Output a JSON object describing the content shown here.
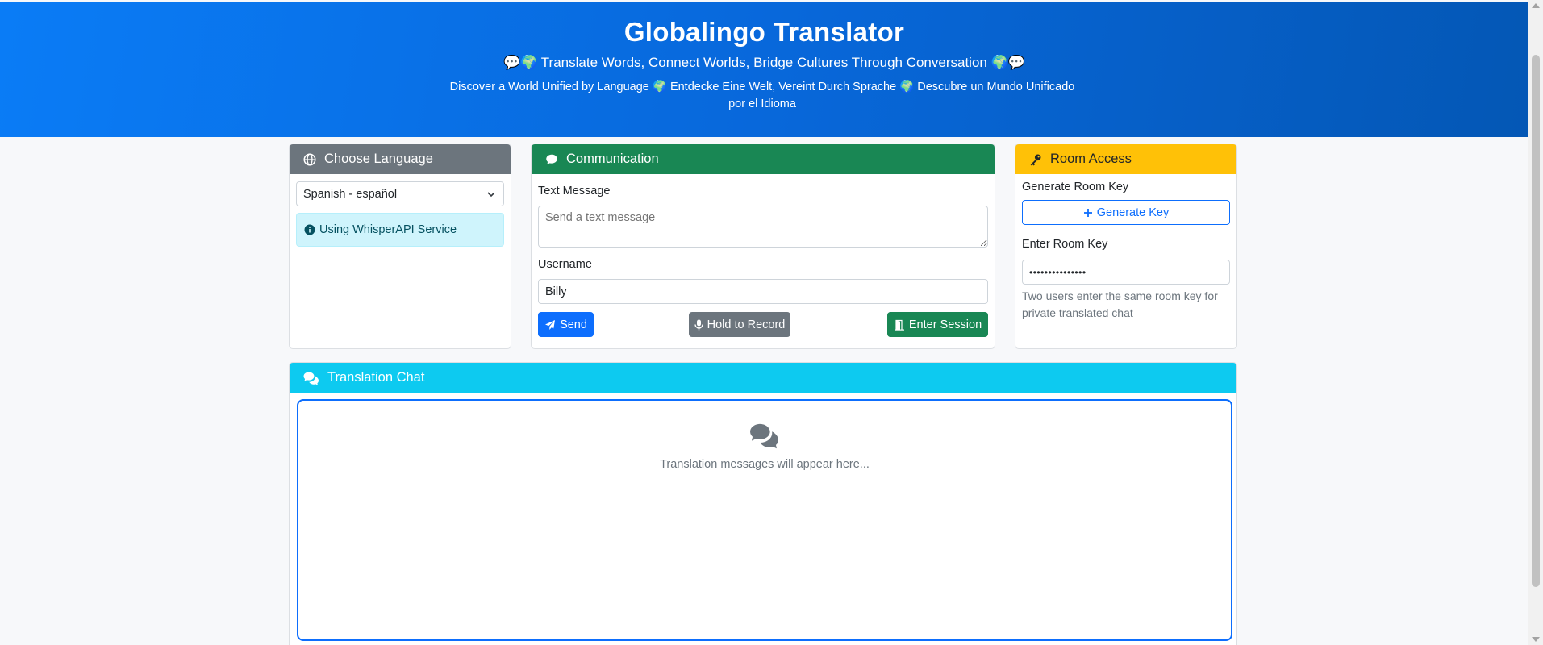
{
  "header": {
    "title": "Globalingo Translator",
    "tagline": "💬🌍 Translate Words, Connect Worlds, Bridge Cultures Through Conversation 🌍💬",
    "subtitle": "Discover a World Unified by Language 🌍 Entdecke Eine Welt, Vereint Durch Sprache 🌍 Descubre un Mundo Unificado por el Idioma"
  },
  "language": {
    "title": "Choose Language",
    "selected": "Spanish - español",
    "service_note": "Using WhisperAPI Service"
  },
  "communication": {
    "title": "Communication",
    "text_label": "Text Message",
    "text_placeholder": "Send a text message",
    "username_label": "Username",
    "username_value": "Billy",
    "send_label": "Send",
    "record_label": "Hold to Record",
    "enter_label": "Enter Session"
  },
  "room": {
    "title": "Room Access",
    "generate_label": "Generate Room Key",
    "generate_button": "Generate Key",
    "enter_label": "Enter Room Key",
    "key_value": "•••••••••••••••",
    "helper": "Two users enter the same room key for private translated chat"
  },
  "chat": {
    "title": "Translation Chat",
    "empty_message": "Translation messages will appear here..."
  },
  "colors": {
    "primary": "#0d6efd",
    "success": "#198754",
    "warning": "#ffc107",
    "info": "#0dcaf0",
    "secondary": "#6c757d"
  }
}
